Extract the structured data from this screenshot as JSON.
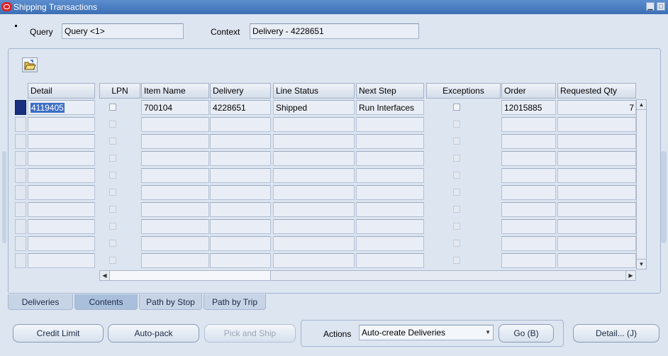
{
  "window": {
    "title": "Shipping Transactions"
  },
  "query": {
    "label": "Query",
    "value": "Query <1>"
  },
  "context": {
    "label": "Context",
    "value": "Delivery - 4228651"
  },
  "table": {
    "headers": {
      "detail": "Detail",
      "lpn": "LPN",
      "item_name": "Item Name",
      "delivery": "Delivery",
      "line_status": "Line Status",
      "next_step": "Next Step",
      "exceptions": "Exceptions",
      "order": "Order",
      "requested_qty": "Requested Qty"
    },
    "rows": [
      {
        "detail": "4119405",
        "item_name": "700104",
        "delivery": "4228651",
        "line_status": "Shipped",
        "next_step": "Run Interfaces",
        "order": "12015885",
        "requested_qty": "7"
      }
    ]
  },
  "tabs": [
    "Deliveries",
    "Contents",
    "Path by Stop",
    "Path by Trip"
  ],
  "buttons": {
    "credit_limit": "Credit Limit",
    "auto_pack": "Auto-pack",
    "pick_and_ship": "Pick and Ship",
    "go": "Go (B)",
    "detail": "Detail... (J)"
  },
  "actions": {
    "label": "Actions",
    "selected": "Auto-create Deliveries"
  },
  "colors": {
    "title_bar": "#3c6eb4",
    "background": "#dde5f1",
    "selected_row": "#1a2f7f"
  }
}
